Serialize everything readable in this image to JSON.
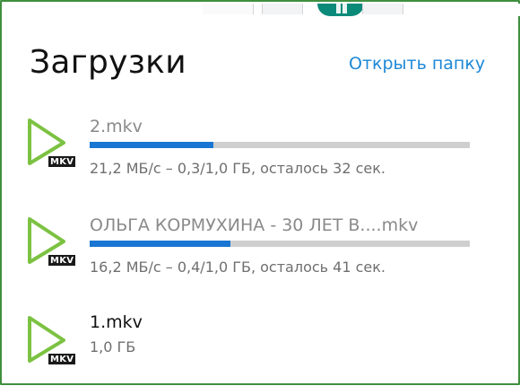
{
  "header": {
    "title": "Загрузки",
    "open_folder_label": "Открыть папку"
  },
  "downloads": [
    {
      "name": "2.mkv",
      "ext": "MKV",
      "progress": 0.325,
      "status": "21,2 МБ/с – 0,3/1,0 ГБ, осталось 32 сек.",
      "state": "in-progress"
    },
    {
      "name": "ОЛЬГА КОРМУХИНА - 30 ЛЕТ В....mkv",
      "ext": "MKV",
      "progress": 0.37,
      "status": "16,2 МБ/с – 0,4/1,0 ГБ, осталось 41 сек.",
      "state": "in-progress"
    },
    {
      "name": "1.mkv",
      "ext": "MKV",
      "progress": 1.0,
      "status": "1,0 ГБ",
      "state": "complete"
    }
  ],
  "colors": {
    "accent": "#1e88d6",
    "progress": "#1976d2",
    "track": "#cfcfcf",
    "icon": "#7cc242"
  },
  "icons": {
    "file": "play-file-icon"
  }
}
